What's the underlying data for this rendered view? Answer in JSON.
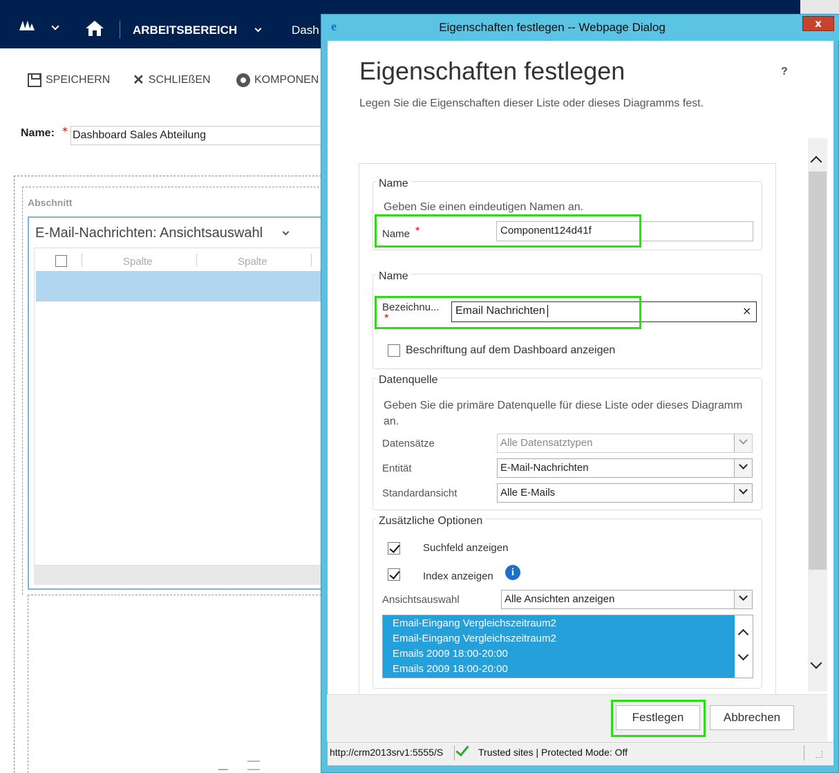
{
  "background": {
    "nav": {
      "workspace_label": "ARBEITSBEREICH",
      "dashboard_label": "Dash"
    },
    "commands": {
      "save_label": "SPEICHERN",
      "close_label": "SCHLIEßEN",
      "component_label": "KOMPONEN"
    },
    "name_field": {
      "label": "Name:",
      "required_mark": "*",
      "value": "Dashboard Sales Abteilung"
    },
    "section_label": "Abschnitt",
    "component_title": "E-Mail-Nachrichten: Ansichtsauswahl",
    "grid_columns": [
      "Spalte",
      "Spalte"
    ]
  },
  "dialog": {
    "window_title": "Eigenschaften festlegen -- Webpage Dialog",
    "close_glyph": "x",
    "heading": "Eigenschaften festlegen",
    "help_glyph": "?",
    "subheading": "Legen Sie die Eigenschaften dieser Liste oder dieses Diagramms fest.",
    "name_section": {
      "legend": "Name",
      "hint": "Geben Sie einen eindeutigen Namen an.",
      "name_label": "Name",
      "required_mark": "*",
      "name_value": "Component124d41f"
    },
    "label_section": {
      "legend": "Name",
      "label_text": "Bezeichnu...",
      "required_mark": "*",
      "label_value": "Email Nachrichten",
      "clear_glyph": "×",
      "show_on_dashboard_label": "Beschriftung auf dem Dashboard anzeigen",
      "show_on_dashboard_checked": false
    },
    "datasource_section": {
      "legend": "Datenquelle",
      "hint": "Geben Sie die primäre Datenquelle für diese Liste oder dieses Diagramm an.",
      "records_label": "Datensätze",
      "records_value": "Alle Datensatztypen",
      "entity_label": "Entität",
      "entity_value": "E-Mail-Nachrichten",
      "default_view_label": "Standardansicht",
      "default_view_value": "Alle E-Mails"
    },
    "options_section": {
      "legend": "Zusätzliche Optionen",
      "search_label": "Suchfeld anzeigen",
      "search_checked": true,
      "index_label": "Index anzeigen",
      "index_checked": true,
      "info_glyph": "i",
      "view_selector_label": "Ansichtsauswahl",
      "view_selector_value": "Alle Ansichten anzeigen",
      "view_list": [
        "Email-Eingang Vergleichszeitraum2",
        "Email-Eingang Vergleichszeitraum2",
        "Emails 2009 18:00-20:00",
        "Emails 2009 18:00-20:00"
      ]
    },
    "buttons": {
      "ok_label": "Festlegen",
      "cancel_label": "Abbrechen"
    },
    "status_bar": {
      "url": "http://crm2013srv1:5555/S",
      "zone_text": "Trusted sites | Protected Mode: Off"
    }
  },
  "colors": {
    "nav_bg": "#002050",
    "dialog_frame": "#5bc0e0",
    "highlight_box": "#2edc16",
    "list_selection": "#26a0da",
    "grid_selection": "#b1d6f0"
  }
}
